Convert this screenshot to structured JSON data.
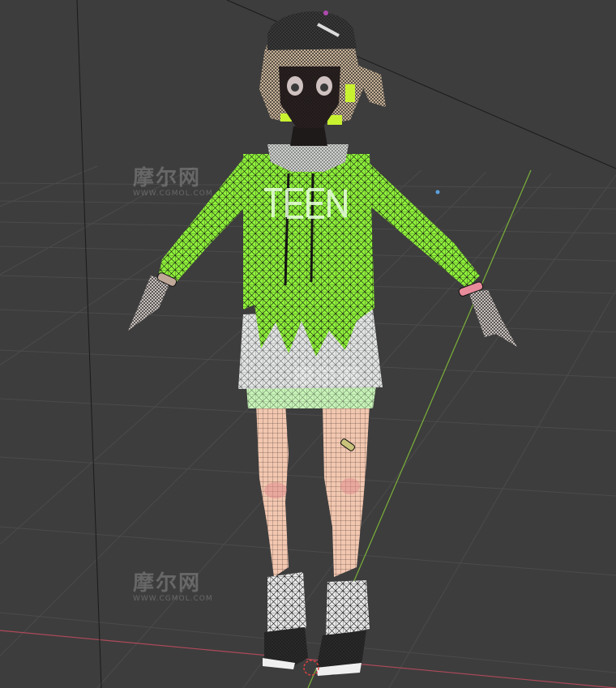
{
  "viewport": {
    "background": "#3d3d3d",
    "grid_color": "#4a4a4a",
    "x_axis_color": "#b04a5a",
    "y_axis_color": "#7ab038"
  },
  "model": {
    "display_mode": "wireframe-overlay",
    "hoodie_color": "#8ff23a",
    "skirt_color": "#e4e6e6",
    "skin_color": "#f2c7b0",
    "hair_color": "#d7c0a4",
    "shoe_color": "#2a2a2a",
    "wire_color": "#111111"
  },
  "watermarks": [
    {
      "text": "摩尔网",
      "subtext": "WWW.CGMOL.COM"
    },
    {
      "text": "摩尔网",
      "subtext": ""
    },
    {
      "text": "摩尔网",
      "subtext": "WWW.CGMOL.COM"
    }
  ],
  "icons": {
    "light_object": "light-icon",
    "origin": "3d-cursor-icon"
  }
}
